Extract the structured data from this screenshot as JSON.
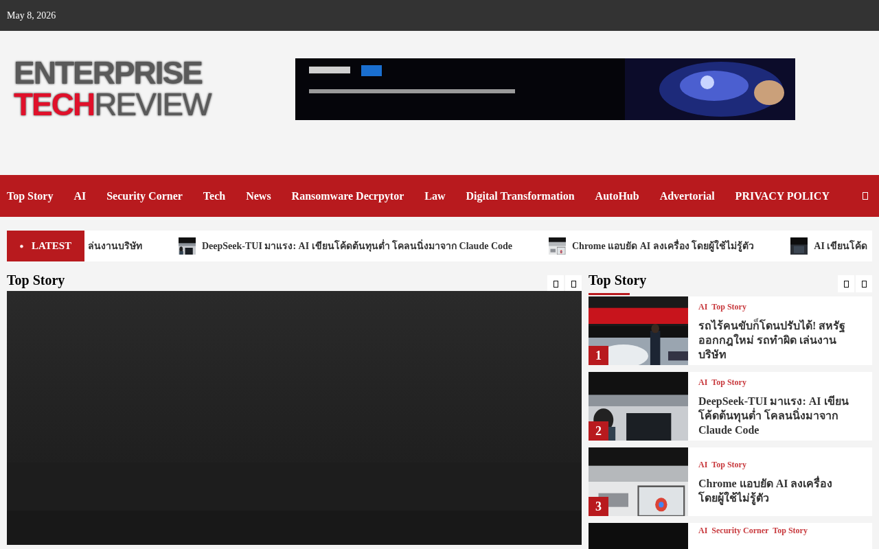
{
  "top_bar": {
    "date": "May 8, 2026"
  },
  "logo": {
    "line_1": "ENTERPRISE",
    "line_2_red": "TECH",
    "line_2_white": "REVIEW"
  },
  "nav": {
    "items": [
      {
        "label": "Top Story"
      },
      {
        "label": "AI"
      },
      {
        "label": "Security Corner"
      },
      {
        "label": "Tech"
      },
      {
        "label": "News"
      },
      {
        "label": "Ransomware Decrpytor"
      },
      {
        "label": "Law"
      },
      {
        "label": "Digital Transformation"
      },
      {
        "label": "AutoHub"
      },
      {
        "label": "Advertorial"
      },
      {
        "label": "PRIVACY POLICY"
      }
    ]
  },
  "ticker": {
    "label": "LATEST",
    "items": [
      {
        "title": "ล่นงานบริษัท",
        "thumbnail": false
      },
      {
        "title": "DeepSeek-TUI มาแรง: AI เขียนโค้ดต้นทุนต่ำ โคลนนิ่งมาจาก Claude Code",
        "thumbnail": true
      },
      {
        "title": "Chrome แอบยัด AI ลงเครื่อง โดยผู้ใช้ไม่รู้ตัว",
        "thumbnail": true
      },
      {
        "title": "AI เขียนโค้ด",
        "thumbnail": true
      }
    ]
  },
  "main_section": {
    "title": "Top Story"
  },
  "side_section": {
    "title": "Top Story",
    "cards": [
      {
        "rank": "1",
        "categories": [
          "AI",
          "Top Story"
        ],
        "title": "รถไร้คนขับก็โดนปรับได้! สหรัฐออกกฎใหม่ รถทำผิด เล่นงานบริษัท"
      },
      {
        "rank": "2",
        "categories": [
          "AI",
          "Top Story"
        ],
        "title": "DeepSeek-TUI มาแรง: AI เขียนโค้ดต้นทุนต่ำ โคลนนิ่งมาจาก Claude Code"
      },
      {
        "rank": "3",
        "categories": [
          "AI",
          "Top Story"
        ],
        "title": "Chrome แอบยัด AI ลงเครื่อง โดยผู้ใช้ไม่รู้ตัว"
      },
      {
        "categories": [
          "AI",
          "Security Corner",
          "Top Story"
        ]
      }
    ]
  }
}
